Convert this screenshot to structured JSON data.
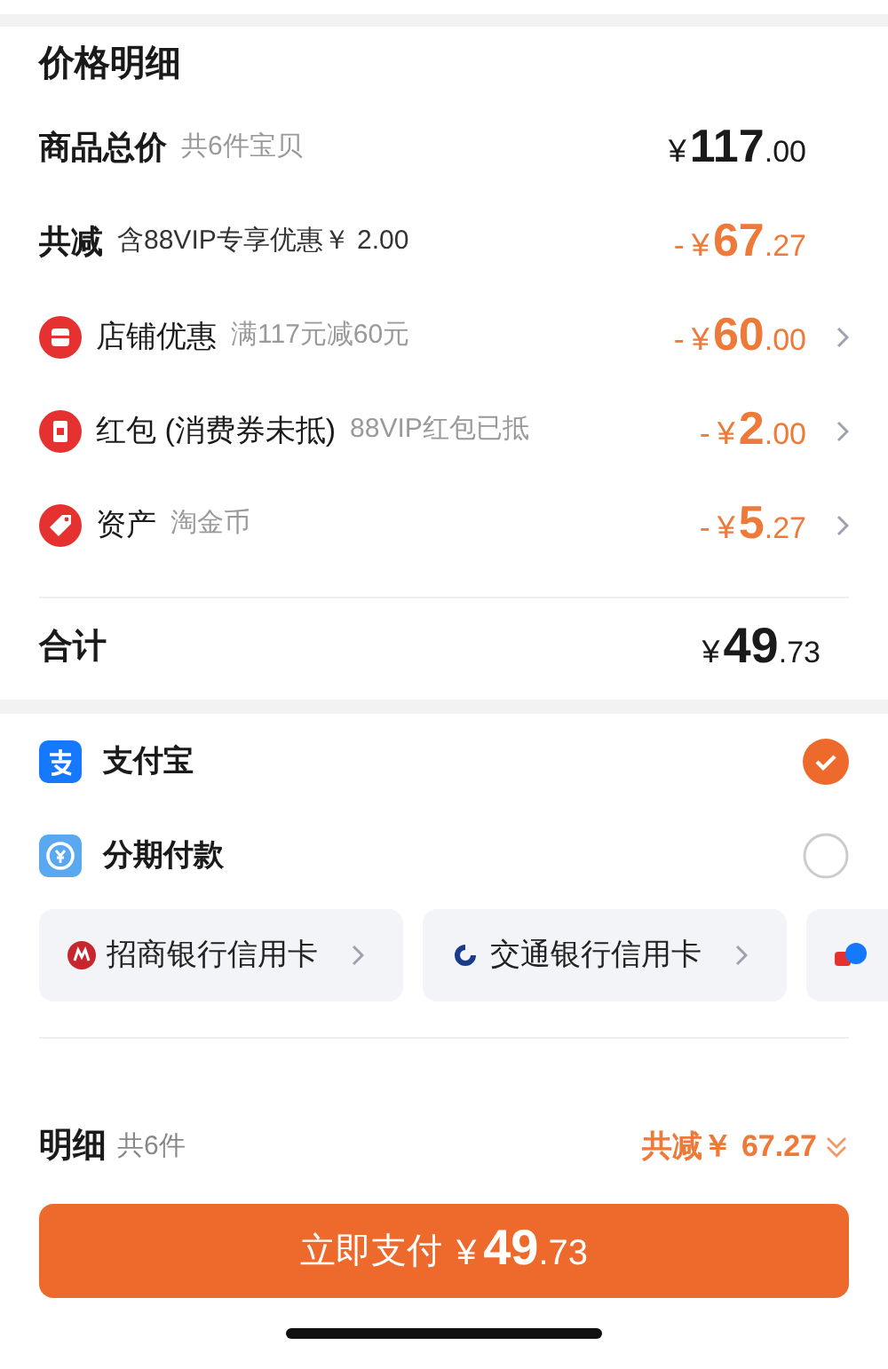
{
  "title": "价格明细",
  "summary": [
    {
      "kind": "plain",
      "label": "商品总价",
      "note": "共6件宝贝",
      "price": {
        "currency": "¥",
        "integer": "117",
        "decimal": ".00"
      },
      "chevron": false
    },
    {
      "kind": "plain",
      "label": "共减",
      "note": "含88VIP专享优惠￥ 2.00",
      "price": {
        "sign": "-",
        "currency": "¥",
        "integer": "67",
        "decimal": ".27"
      },
      "chevron": false
    },
    {
      "kind": "shop",
      "label": "店铺优惠",
      "note": "满117元减60元",
      "price": {
        "sign": "-",
        "currency": "¥",
        "integer": "60",
        "decimal": ".00"
      },
      "chevron": true
    },
    {
      "kind": "redpacket",
      "label": "红包 (消费券未抵)",
      "note": "88VIP红包已抵",
      "price": {
        "sign": "-",
        "currency": "¥",
        "integer": "2",
        "decimal": ".00"
      },
      "chevron": true
    },
    {
      "kind": "tag",
      "label": "资产",
      "note": "淘金币",
      "price": {
        "sign": "-",
        "currency": "¥",
        "integer": "5",
        "decimal": ".27"
      },
      "chevron": true
    }
  ],
  "total": {
    "label": "合计",
    "price": {
      "currency": "¥",
      "integer": "49",
      "decimal": ".73"
    }
  },
  "payment_methods": [
    {
      "kind": "alipay",
      "label": "支付宝",
      "selected": true
    },
    {
      "kind": "installment",
      "label": "分期付款",
      "selected": false
    }
  ],
  "cards": [
    {
      "kind": "cmb",
      "label": "招商银行信用卡"
    },
    {
      "kind": "bocom",
      "label": "交通银行信用卡"
    },
    {
      "kind": "other"
    }
  ],
  "footer": {
    "label": "明细",
    "count": "共6件",
    "discount": "共减￥ 67.27"
  },
  "pay_button": {
    "label": "立即支付",
    "price": {
      "currency": "¥",
      "integer": "49",
      "decimal": ".73"
    }
  }
}
